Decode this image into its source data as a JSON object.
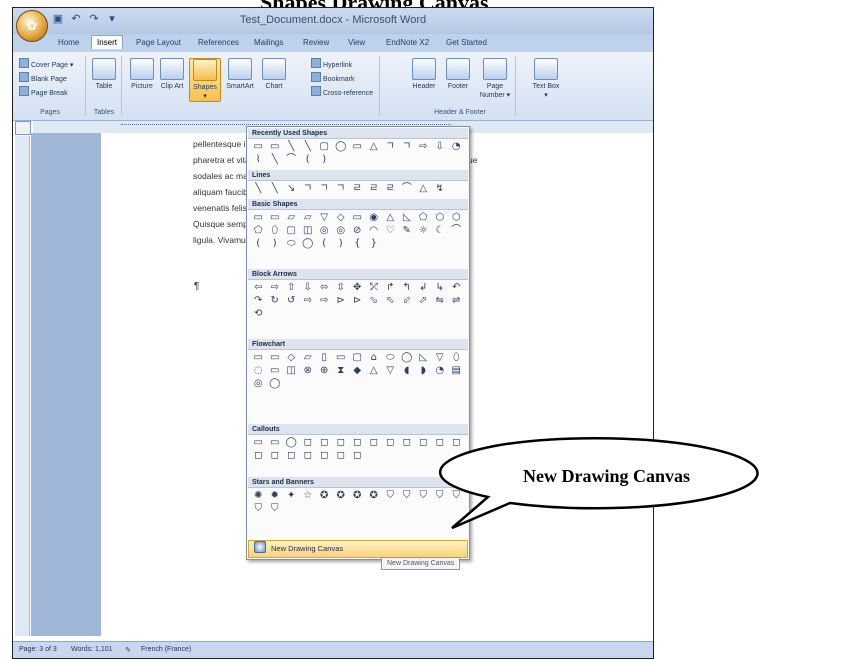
{
  "heading": {
    "text": "Shapes Drawing Canvas"
  },
  "window": {
    "title": "Test_Document.docx - Microsoft Word"
  },
  "ribbon": {
    "tabs": [
      "Home",
      "Insert",
      "Page Layout",
      "References",
      "Mailings",
      "Review",
      "View",
      "EndNote X2",
      "Get Started"
    ],
    "active_tab": "Insert",
    "pages_group": {
      "cover_page": "Cover Page ▾",
      "blank_page": "Blank Page",
      "page_break": "Page Break",
      "label": "Pages"
    },
    "tables_group": {
      "table": "Table",
      "label": "Tables"
    },
    "illustrations_group": {
      "picture": "Picture",
      "clip_art": "Clip Art",
      "shapes": "Shapes",
      "smartart": "SmartArt",
      "chart": "Chart"
    },
    "links_group": {
      "hyperlink": "Hyperlink",
      "bookmark": "Bookmark",
      "cross_reference": "Cross-reference"
    },
    "header_footer_group": {
      "header": "Header",
      "footer": "Footer",
      "page_number": "Page Number ▾",
      "label": "Header & Footer"
    },
    "text_group": {
      "text_box": "Text Box ▾"
    }
  },
  "document": {
    "lines": [
      "pellentesque in lacinia. Donec dictum consectetur eleifend. Etiam nec",
      "pharetra et vitae ultricies erat blandit sodales, odio quis sodales scelerisque",
      "sodales ac malesuada tempor. Phasellus ac rhoncus massa. Fusce",
      "aliquam faucibus turpis. Integer vehicula quis dictum elit euismod. Nulla",
      "venenatis felis. Duis in mollis ipsum vel leo tincidunt vel molestie",
      "Quisque semper convallis ipsum urna, tincidunt eu pellentesque",
      "ligula. Vivamus sed aliquam justo a."
    ],
    "pilcrow": "¶"
  },
  "shapes_menu": {
    "recent": {
      "label": "Recently Used Shapes",
      "glyphs": [
        "▭",
        "▭",
        "╲",
        "╲",
        "▢",
        "◯",
        "▭",
        "△",
        "ㄱ",
        "ㄱ",
        "⇨",
        "⇩",
        "◔",
        "⌇",
        "╲",
        "⌒",
        "(",
        ")"
      ]
    },
    "lines": {
      "label": "Lines",
      "glyphs": [
        "╲",
        "╲",
        "↘",
        "ㄱ",
        "ㄱ",
        "ㄱ",
        "ㄹ",
        "ㄹ",
        "ㄹ",
        "⌒",
        "△",
        "↯"
      ]
    },
    "basic": {
      "label": "Basic Shapes",
      "glyphs": [
        "▭",
        "▭",
        "▱",
        "▱",
        "▽",
        "◇",
        "▭",
        "◉",
        "△",
        "◺",
        "⬠",
        "⬡",
        "⬡",
        "⬠",
        "⬯",
        "▢",
        "◫",
        "◎",
        "◎",
        "⊘",
        "◠",
        "♡",
        "✎",
        "☼",
        "☾",
        "⌒",
        "(",
        ")",
        "⬭",
        "◯",
        "(",
        ")",
        "{",
        "}"
      ]
    },
    "block_arrows": {
      "label": "Block Arrows",
      "glyphs": [
        "⇦",
        "⇨",
        "⇧",
        "⇩",
        "⬄",
        "⇳",
        "✥",
        "⤱",
        "↱",
        "↰",
        "↲",
        "↳",
        "↶",
        "↷",
        "↻",
        "↺",
        "⇨",
        "⇨",
        "⊳",
        "⊳",
        "⬂",
        "⬁",
        "⬃",
        "⬀",
        "⇋",
        "⇌",
        "⟲"
      ]
    },
    "flowchart": {
      "label": "Flowchart",
      "glyphs": [
        "▭",
        "▭",
        "◇",
        "▱",
        "▯",
        "▭",
        "▢",
        "⌂",
        "⬭",
        "◯",
        "◺",
        "▽",
        "⬯",
        "◌",
        "▭",
        "◫",
        "⊗",
        "⊕",
        "⧗",
        "◆",
        "△",
        "▽",
        "◖",
        "◗",
        "◔",
        "▤",
        "◎",
        "◯"
      ]
    },
    "callouts": {
      "label": "Callouts",
      "glyphs": [
        "▭",
        "▭",
        "◯",
        "◻",
        "◻",
        "◻",
        "◻",
        "◻",
        "◻",
        "◻",
        "◻",
        "◻",
        "◻",
        "◻",
        "◻",
        "◻",
        "◻",
        "◻",
        "◻",
        "◻"
      ]
    },
    "stars": {
      "label": "Stars and Banners",
      "glyphs": [
        "✺",
        "✹",
        "✦",
        "☆",
        "✪",
        "✪",
        "✪",
        "✪",
        "⛉",
        "⛉",
        "⛉",
        "⛉",
        "⛉",
        "⛉",
        "⛉"
      ]
    },
    "new_canvas": "New Drawing Canvas"
  },
  "tooltip": "New Drawing Canvas",
  "callout": {
    "text": "New Drawing Canvas"
  },
  "status_bar": {
    "page": "Page: 3 of 3",
    "words": "Words: 1,101",
    "language": "French (France)"
  }
}
